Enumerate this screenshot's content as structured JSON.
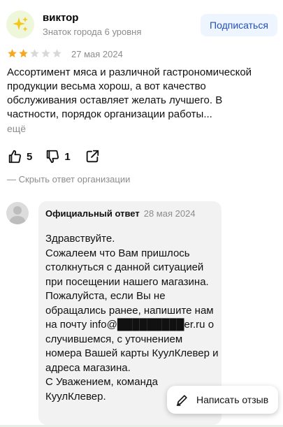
{
  "author": {
    "avatar_icon": "sparkles-icon",
    "name": "виктор",
    "level": "Знаток города 6 уровня"
  },
  "subscribe_label": "Подписаться",
  "review": {
    "rating": 2,
    "max_rating": 5,
    "date": "27 мая 2024",
    "text": "Ассортимент мяса и различной гастрономической продукции весьма хорош, а вот качество обслуживания оставляет желать лучшего. В частности, порядок организации работы...",
    "more_label": "ещё"
  },
  "actions": {
    "likes": "5",
    "dislikes": "1"
  },
  "hide_reply_label": "— Скрыть ответ организации",
  "org_reply": {
    "label": "Официальный ответ",
    "date": "28 мая 2024",
    "text": "Здравствуйте.\nСожалеем что Вам пришлось столкнуться с данной ситуацией при посещении нашего магазина. Пожалуйста, если Вы не обращались ранее, напишите нам на почту info@█████████er.ru о случившемся, с уточнением номера Вашей карты КуулКлевер и адреса магазина.\nС Уважением, команда КуулКлевер."
  },
  "write_review_label": "Написать отзыв",
  "colors": {
    "star_filled": "#f5a623",
    "star_empty": "#d9d9d9",
    "subscribe_bg": "#eef5ff",
    "subscribe_text": "#1f4fbf",
    "muted": "#8c8c8c",
    "reply_bg": "#f2f2f2"
  }
}
